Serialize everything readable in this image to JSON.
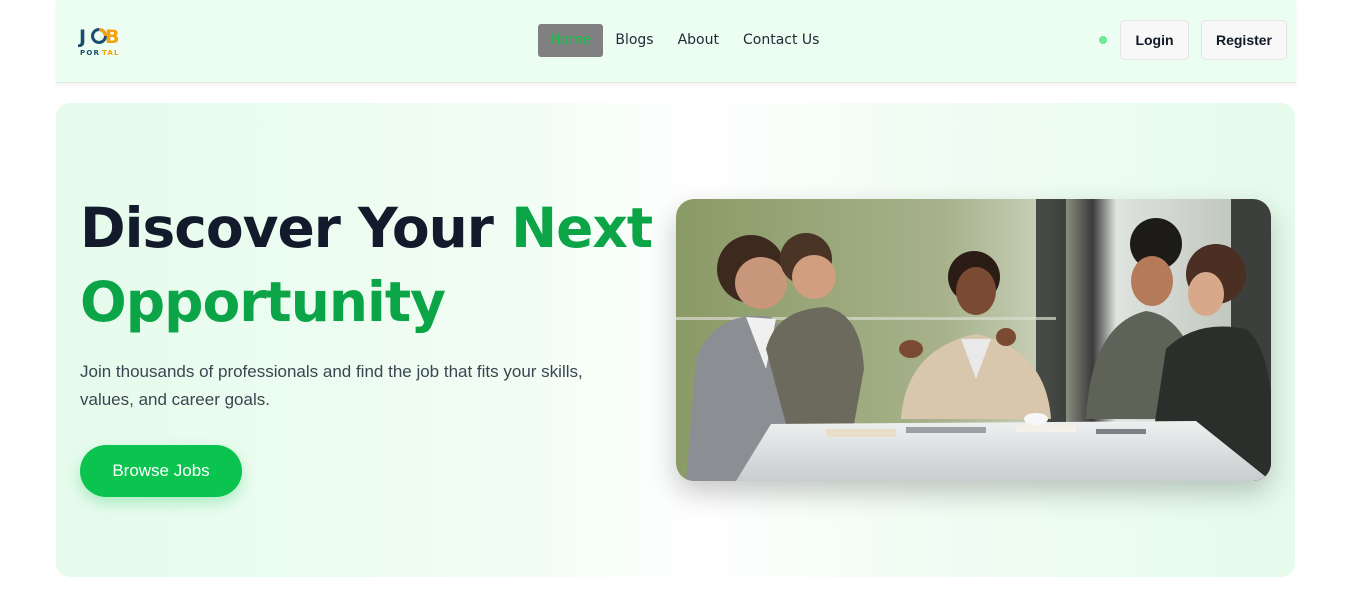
{
  "brand": {
    "logo_top": "JOB",
    "logo_bottom": "PORTAL"
  },
  "nav": {
    "links": [
      {
        "label": "Home",
        "active": true
      },
      {
        "label": "Blogs",
        "active": false
      },
      {
        "label": "About",
        "active": false
      },
      {
        "label": "Contact Us",
        "active": false
      }
    ],
    "login_label": "Login",
    "register_label": "Register"
  },
  "hero": {
    "title_part1": "Discover Your ",
    "title_accent1": "Next",
    "title_accent2": "Opportunity",
    "subtitle": "Join thousands of professionals and find the job that fits your skills, values, and career goals.",
    "cta_label": "Browse Jobs",
    "image_icon": "team-meeting-photo"
  },
  "colors": {
    "accent_green": "#0ba548",
    "button_green": "#0bc44f",
    "nav_background": "#ecfdf1",
    "active_nav_background": "#808080",
    "title_dark": "#121a2c"
  }
}
